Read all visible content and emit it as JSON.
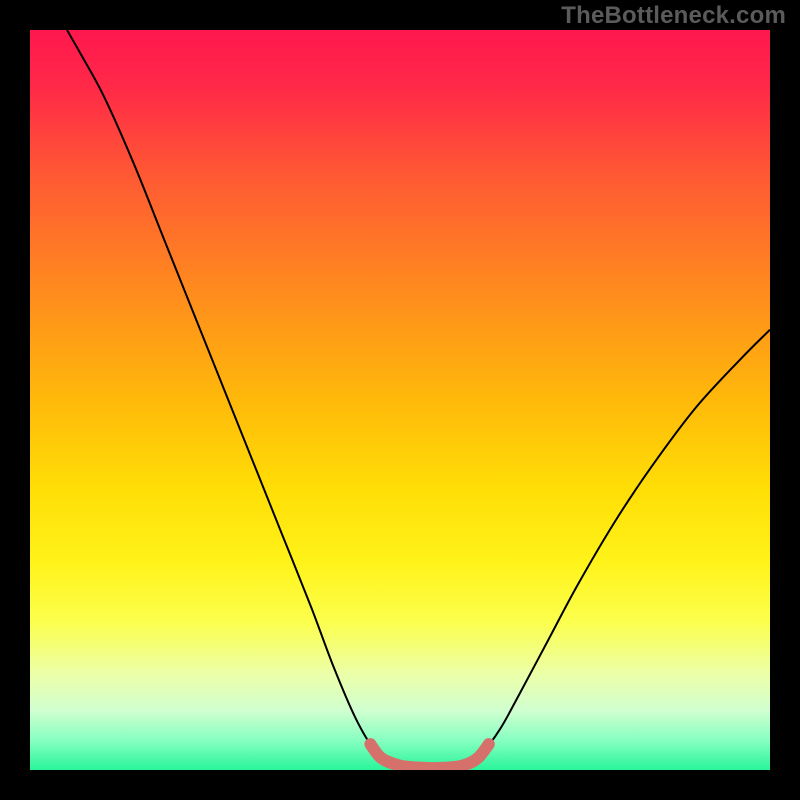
{
  "watermark": "TheBottleneck.com",
  "chart_data": {
    "type": "line",
    "title": "",
    "xlabel": "",
    "ylabel": "",
    "xlim": [
      0,
      1
    ],
    "ylim": [
      0,
      1
    ],
    "background_gradient": {
      "stops": [
        {
          "offset": 0.0,
          "color": "#ff174e"
        },
        {
          "offset": 0.08,
          "color": "#ff2a47"
        },
        {
          "offset": 0.2,
          "color": "#ff5a33"
        },
        {
          "offset": 0.35,
          "color": "#ff8a1e"
        },
        {
          "offset": 0.5,
          "color": "#ffb90a"
        },
        {
          "offset": 0.62,
          "color": "#ffde06"
        },
        {
          "offset": 0.72,
          "color": "#fff31a"
        },
        {
          "offset": 0.8,
          "color": "#fbff4d"
        },
        {
          "offset": 0.87,
          "color": "#ecffa8"
        },
        {
          "offset": 0.92,
          "color": "#d0ffd0"
        },
        {
          "offset": 0.96,
          "color": "#86ffc0"
        },
        {
          "offset": 1.0,
          "color": "#28f59a"
        }
      ]
    },
    "series": [
      {
        "name": "bottleneck-curve",
        "stroke": "#000000",
        "stroke_width": 2,
        "points": [
          {
            "x": 0.05,
            "y": 1.0
          },
          {
            "x": 0.07,
            "y": 0.965
          },
          {
            "x": 0.1,
            "y": 0.91
          },
          {
            "x": 0.14,
            "y": 0.82
          },
          {
            "x": 0.18,
            "y": 0.72
          },
          {
            "x": 0.22,
            "y": 0.62
          },
          {
            "x": 0.26,
            "y": 0.52
          },
          {
            "x": 0.3,
            "y": 0.42
          },
          {
            "x": 0.34,
            "y": 0.32
          },
          {
            "x": 0.38,
            "y": 0.22
          },
          {
            "x": 0.41,
            "y": 0.14
          },
          {
            "x": 0.44,
            "y": 0.07
          },
          {
            "x": 0.465,
            "y": 0.028
          },
          {
            "x": 0.49,
            "y": 0.008
          },
          {
            "x": 0.52,
            "y": 0.003
          },
          {
            "x": 0.56,
            "y": 0.003
          },
          {
            "x": 0.59,
            "y": 0.008
          },
          {
            "x": 0.61,
            "y": 0.022
          },
          {
            "x": 0.635,
            "y": 0.055
          },
          {
            "x": 0.66,
            "y": 0.1
          },
          {
            "x": 0.7,
            "y": 0.175
          },
          {
            "x": 0.74,
            "y": 0.25
          },
          {
            "x": 0.79,
            "y": 0.335
          },
          {
            "x": 0.84,
            "y": 0.41
          },
          {
            "x": 0.9,
            "y": 0.49
          },
          {
            "x": 0.96,
            "y": 0.555
          },
          {
            "x": 1.0,
            "y": 0.595
          }
        ]
      },
      {
        "name": "optimal-band",
        "stroke": "#d6706b",
        "stroke_width": 12,
        "linecap": "round",
        "points": [
          {
            "x": 0.46,
            "y": 0.035
          },
          {
            "x": 0.475,
            "y": 0.016
          },
          {
            "x": 0.5,
            "y": 0.006
          },
          {
            "x": 0.53,
            "y": 0.003
          },
          {
            "x": 0.56,
            "y": 0.003
          },
          {
            "x": 0.585,
            "y": 0.006
          },
          {
            "x": 0.605,
            "y": 0.016
          },
          {
            "x": 0.62,
            "y": 0.035
          }
        ]
      }
    ]
  }
}
